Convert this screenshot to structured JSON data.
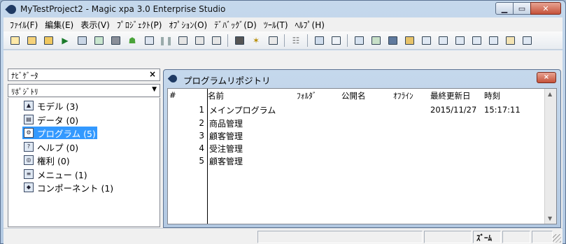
{
  "window": {
    "title": "MyTestProject2 - Magic xpa 3.0 Enterprise Studio"
  },
  "menu": [
    {
      "label": "ﾌｧｲﾙ(F)"
    },
    {
      "label": "編集(E)"
    },
    {
      "label": "表示(V)"
    },
    {
      "label": "ﾌﾟﾛｼﾞｪｸﾄ(P)"
    },
    {
      "label": "ｵﾌﾟｼｮﾝ(O)"
    },
    {
      "label": "ﾃﾞﾊﾞｯｸﾞ(D)"
    },
    {
      "label": "ﾂｰﾙ(T)"
    },
    {
      "label": "ﾍﾙﾌﾟ(H)"
    }
  ],
  "navigator": {
    "title": "ﾅﾋﾞｹﾞｰﾀ",
    "close": "×",
    "repository_select": "ﾘﾎﾟｼﾞﾄﾘ",
    "items": [
      {
        "label": "モデル (3)",
        "icon": "models-icon"
      },
      {
        "label": "データ (0)",
        "icon": "data-icon"
      },
      {
        "label": "プログラム (5)",
        "icon": "programs-icon",
        "selected": true
      },
      {
        "label": "ヘルプ (0)",
        "icon": "help-icon"
      },
      {
        "label": "権利 (0)",
        "icon": "rights-icon"
      },
      {
        "label": "メニュー (1)",
        "icon": "menu-icon"
      },
      {
        "label": "コンポーネント (1)",
        "icon": "components-icon"
      }
    ]
  },
  "repository": {
    "title": "プログラムリポジトリ",
    "close": "×",
    "columns": {
      "num": "#",
      "name": "名前",
      "folder": "ﾌｫﾙﾀﾞ",
      "public": "公開名",
      "offline": "ｵﾌﾗｲﾝ",
      "updated": "最終更新日",
      "time": "時刻"
    },
    "rows": [
      {
        "num": "1",
        "name": "メインプログラム",
        "updated": "2015/11/27",
        "time": "15:17:11"
      },
      {
        "num": "2",
        "name": "商品管理",
        "updated": "",
        "time": ""
      },
      {
        "num": "3",
        "name": "顧客管理",
        "updated": "",
        "time": ""
      },
      {
        "num": "4",
        "name": "受注管理",
        "updated": "",
        "time": ""
      },
      {
        "num": "5",
        "name": "顧客管理",
        "updated": "",
        "time": ""
      }
    ]
  },
  "statusbar": {
    "mode": "ｽﾞｰﾑ"
  }
}
